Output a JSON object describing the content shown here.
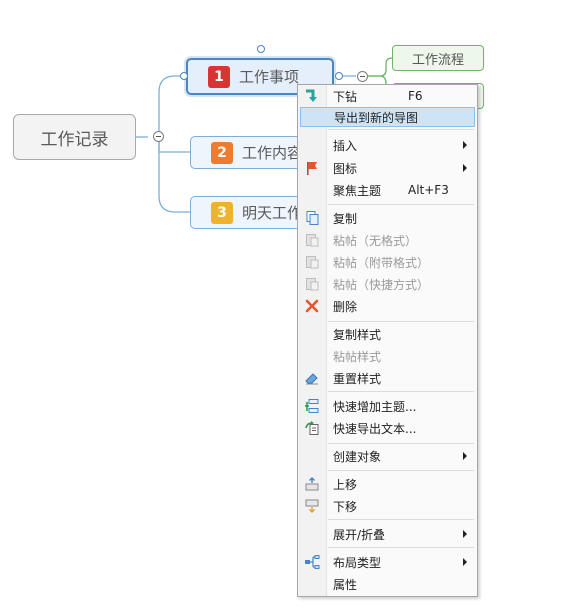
{
  "mindmap": {
    "central": "工作记录",
    "topics": [
      {
        "number": "1",
        "label": "工作事项",
        "color": "#d93434"
      },
      {
        "number": "2",
        "label": "工作内容",
        "color": "#ef7c2e"
      },
      {
        "number": "3",
        "label": "明天工作",
        "color": "#efb22e"
      }
    ],
    "subtopics": [
      "工作流程"
    ]
  },
  "context_menu": {
    "items": [
      {
        "label": "下钻",
        "shortcut": "F6",
        "icon": "drill-down-icon"
      },
      {
        "label": "导出到新的导图",
        "highlighted": true
      },
      {
        "label": "插入",
        "submenu": true
      },
      {
        "label": "图标",
        "submenu": true,
        "icon": "flag-icon"
      },
      {
        "label": "聚焦主题",
        "shortcut": "Alt+F3"
      },
      {
        "label": "复制",
        "icon": "copy-icon"
      },
      {
        "label": "粘帖（无格式）",
        "disabled": true,
        "icon": "paste-icon"
      },
      {
        "label": "粘帖（附带格式）",
        "disabled": true,
        "icon": "paste-icon"
      },
      {
        "label": "粘帖（快捷方式）",
        "disabled": true,
        "icon": "paste-icon"
      },
      {
        "label": "删除",
        "icon": "delete-icon"
      },
      {
        "label": "复制样式"
      },
      {
        "label": "粘帖样式",
        "disabled": true
      },
      {
        "label": "重置样式",
        "icon": "eraser-icon"
      },
      {
        "label": "快速增加主题...",
        "icon": "add-topics-icon"
      },
      {
        "label": "快速导出文本...",
        "icon": "export-text-icon"
      },
      {
        "label": "创建对象",
        "submenu": true
      },
      {
        "label": "上移",
        "icon": "move-up-icon"
      },
      {
        "label": "下移",
        "icon": "move-down-icon"
      },
      {
        "label": "展开/折叠",
        "submenu": true
      },
      {
        "label": "布局类型",
        "submenu": true,
        "icon": "layout-icon"
      },
      {
        "label": "属性"
      }
    ]
  },
  "colors": {
    "accent": "#4a84c4",
    "menu_highlight": "#cde4f7"
  }
}
